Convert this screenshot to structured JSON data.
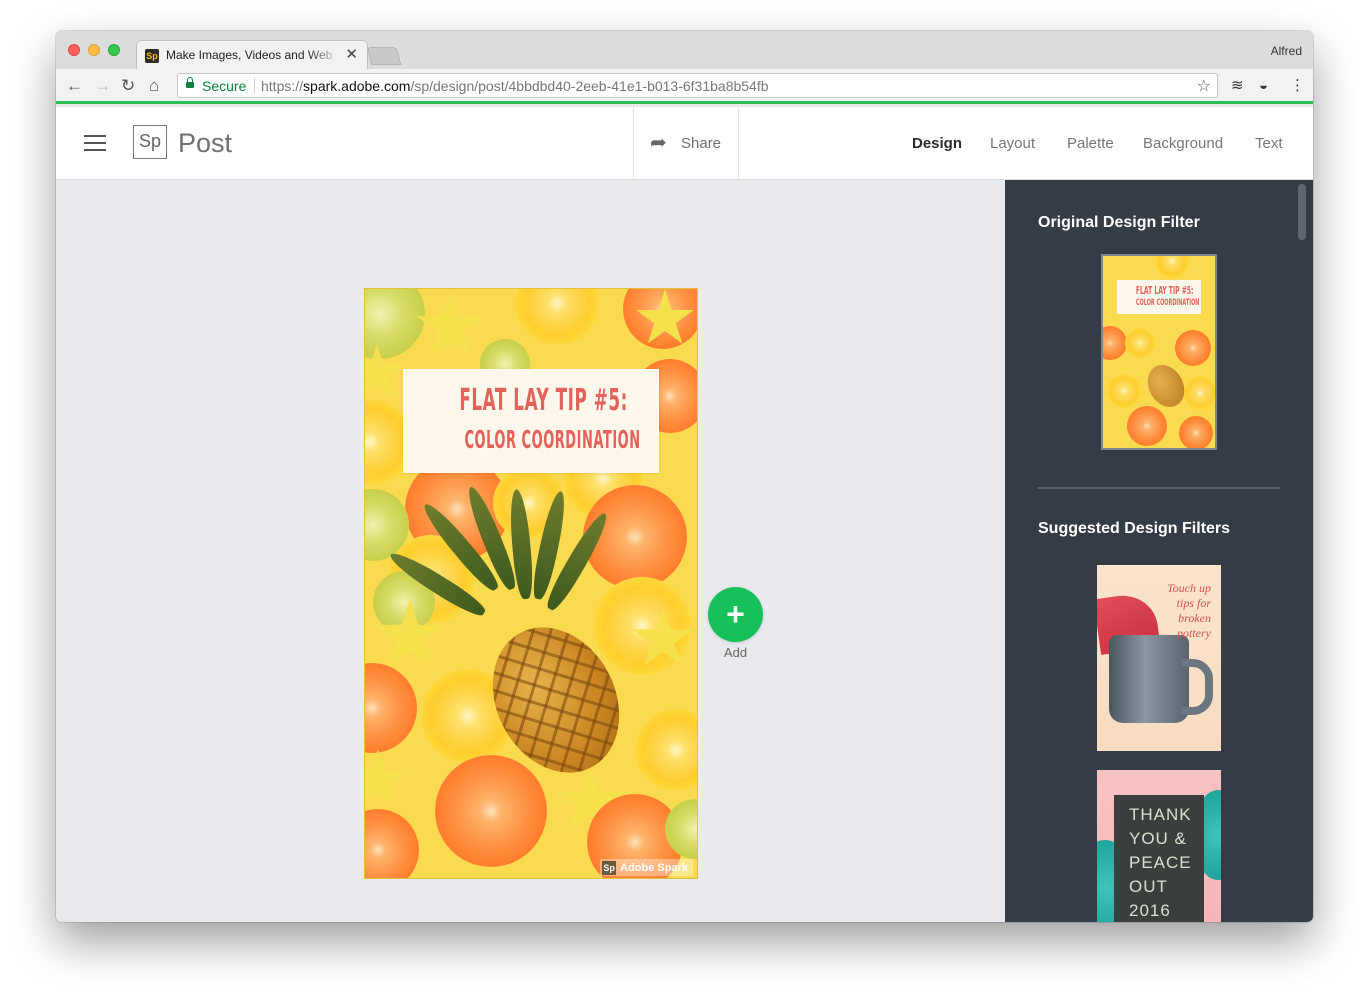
{
  "browser": {
    "tab_title": "Make Images, Videos and Web",
    "tab_close": "✕",
    "profile_name": "Alfred",
    "secure_label": "Secure",
    "url_scheme": "https://",
    "url_host": "spark.adobe.com",
    "url_path": "/sp/design/post/4bbdbd40-2eeb-41e1-b013-6f31ba8b54fb"
  },
  "app": {
    "logo_text": "Sp",
    "title": "Post",
    "share_label": "Share",
    "nav_tabs": [
      {
        "label": "Design",
        "active": true
      },
      {
        "label": "Layout",
        "active": false
      },
      {
        "label": "Palette",
        "active": false
      },
      {
        "label": "Background",
        "active": false
      },
      {
        "label": "Text",
        "active": false
      }
    ]
  },
  "poster": {
    "title_line1": "FLAT LAY TIP #5:",
    "title_line2": "COLOR COORDINATION",
    "watermark_logo": "Sp",
    "watermark_text": "Adobe Spark"
  },
  "add_button": {
    "icon": "+",
    "label": "Add"
  },
  "panel": {
    "original_heading": "Original Design Filter",
    "suggested_heading": "Suggested Design Filters",
    "original_thumb": {
      "line1": "FLAT LAY TIP #5:",
      "line2": "COLOR COORDINATION"
    },
    "pottery_thumb": {
      "lines": [
        "Touch up",
        "tips for",
        "broken",
        "pottery"
      ]
    },
    "thanks_thumb": {
      "lines": [
        "THANK",
        "YOU &",
        "PEACE",
        "OUT",
        "2016"
      ]
    }
  },
  "colors": {
    "accent_green": "#17c15a",
    "load_bar": "#2bbf4f",
    "panel_bg": "#343c46",
    "poster_title": "#e4625a",
    "poster_bg": "#fada4f"
  }
}
